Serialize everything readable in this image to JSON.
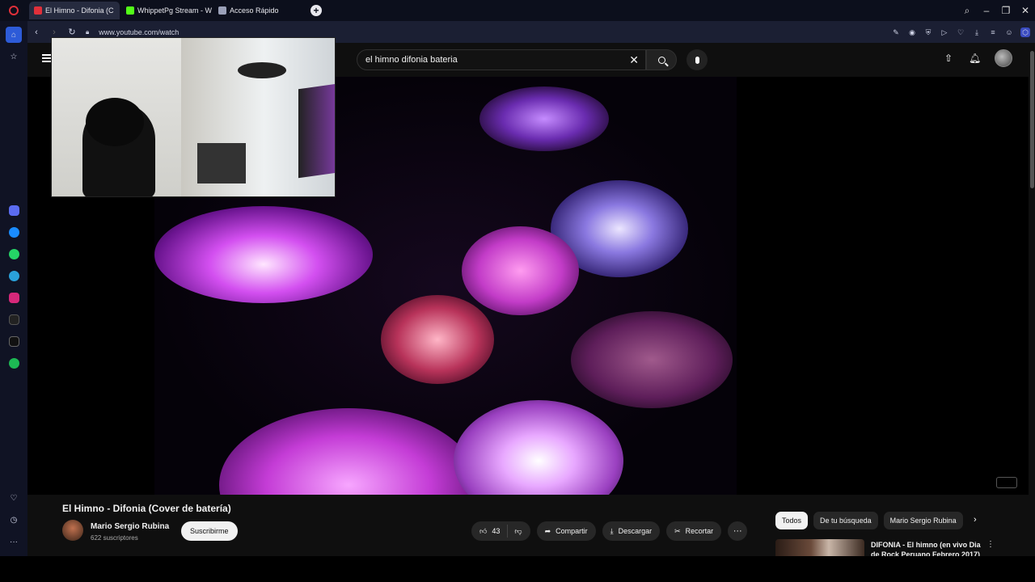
{
  "tabs": [
    {
      "title": "El Himno - Difonia (C",
      "active": true,
      "favicon_color": "#e0303a"
    },
    {
      "title": "WhippetPg Stream - Wate",
      "active": false,
      "favicon_color": "#53fc18"
    },
    {
      "title": "Acceso Rápido",
      "active": false,
      "favicon_color": "#9aa0b8"
    }
  ],
  "address": {
    "url": "www.youtube.com/watch"
  },
  "search": {
    "query": "el himno difonia bateria"
  },
  "video": {
    "title": "El Himno - Difonia (Cover de batería)"
  },
  "channel": {
    "name": "Mario Sergio Rubina",
    "subscribers": "622 suscriptores"
  },
  "actions": {
    "subscribe": "Suscribirme",
    "likes": "43",
    "share": "Compartir",
    "download": "Descargar",
    "clip": "Recortar",
    "more": "···"
  },
  "chips": [
    "Todos",
    "De tu búsqueda",
    "Mario Sergio Rubina"
  ],
  "recommendation": {
    "title": "DIFONIA - El himno (en vivo Dia de Rock Peruano Febrero 2017)"
  },
  "colors": {
    "accent_red": "#e0303a",
    "page_bg": "#0f0f0f",
    "pill_bg": "#272727"
  }
}
